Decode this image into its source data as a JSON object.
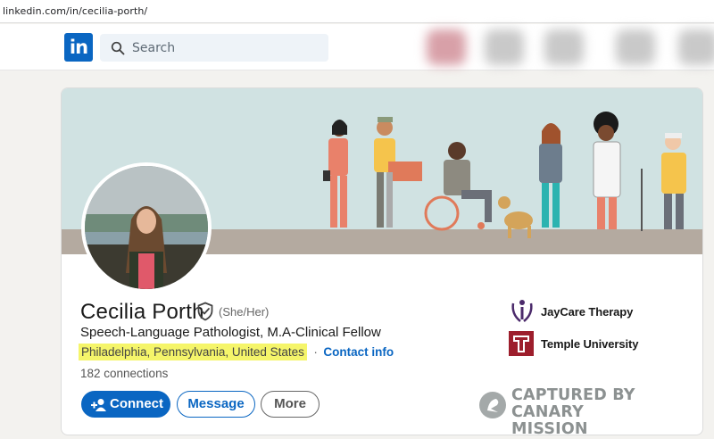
{
  "browser": {
    "url": "linkedin.com/in/cecilia-porth/"
  },
  "nav": {
    "logo": "in",
    "search_placeholder": "Search"
  },
  "profile": {
    "name": "Cecilia Porth",
    "pronouns": "(She/Her)",
    "headline": "Speech-Language Pathologist, M.A-Clinical Fellow",
    "location": "Philadelphia, Pennsylvania, United States",
    "separator": "·",
    "contact_info": "Contact info",
    "connections": "182 connections"
  },
  "actions": {
    "connect": "Connect",
    "message": "Message",
    "more": "More"
  },
  "organizations": [
    {
      "name": "JayCare Therapy",
      "icon": "jaycare-logo-icon"
    },
    {
      "name": "Temple University",
      "icon": "temple-logo-icon"
    }
  ],
  "watermark": {
    "line1": "CAPTURED BY",
    "line2": "CANARY MISSION"
  },
  "colors": {
    "brand": "#0a66c2",
    "highlight": "#f5f56a",
    "banner": "#d0e2e2",
    "temple": "#9d1e2c",
    "jaycare": "#4b2a6b"
  }
}
